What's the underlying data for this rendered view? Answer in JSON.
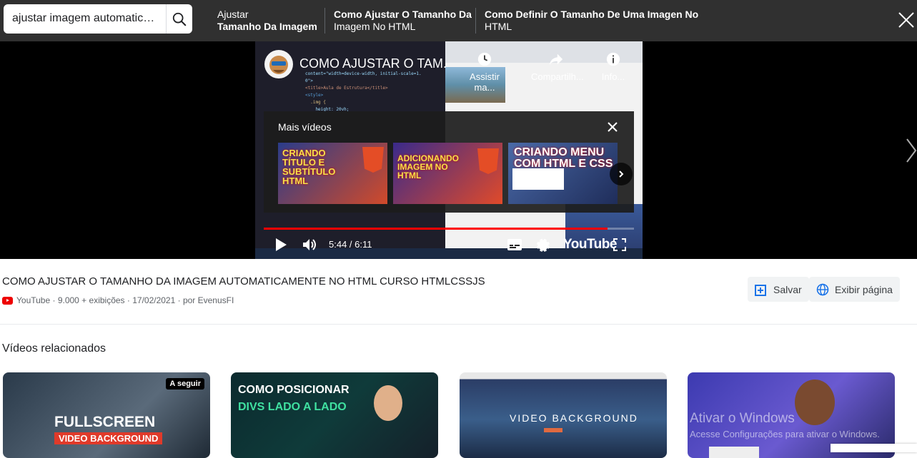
{
  "search": {
    "query": "ajustar imagem automaticamente no html"
  },
  "suggestions": [
    {
      "line1": "Ajustar",
      "line2": "Tamanho Da Imagem"
    },
    {
      "line1": "Como Ajustar O Tamanho Da",
      "line2": "Imagem No HTML"
    },
    {
      "line1": "Como Definir O Tamanho De Uma Imagen No",
      "line2": "HTML"
    }
  ],
  "player": {
    "title": "COMO AJUSTAR O TAM...",
    "watch_later": "Assistir ma...",
    "share": "Compartilh...",
    "info": "Info...",
    "more_videos": "Mais vídeos",
    "time": "5:44 / 6:11",
    "progress": 0.928,
    "brand": "YouTube",
    "more_thumbs": [
      {
        "text": "CRIANDO TÍTULO E SUBTÍTULO HTML",
        "badge": "HTML"
      },
      {
        "text": "ADICIONANDO IMAGEM NO HTML",
        "badge": "HTML"
      },
      {
        "text": "CRIANDO MENU COM HTML E CSS",
        "badge": "HTML"
      }
    ]
  },
  "video": {
    "title": "COMO AJUSTAR O TAMANHO DA IMAGEM AUTOMATICAMENTE NO HTML CURSO HTMLCSSJS",
    "meta": "YouTube · 9.000 + exibições · 17/02/2021 · por EvenusFI",
    "save": "Salvar",
    "open_page": "Exibir página"
  },
  "related": {
    "heading": "Vídeos relacionados",
    "cards": [
      {
        "line1": "FULLSCREEN",
        "line2": "VIDEO BACKGROUND",
        "badge": "A seguir"
      },
      {
        "line1": "COMO POSICIONAR",
        "line2": "DIVS LADO A LADO"
      },
      {
        "line1": "VIDEO BACKGROUND",
        "line2": ""
      },
      {
        "line1": "",
        "line2": ""
      }
    ]
  },
  "windows": {
    "activate": "Ativar o Windows",
    "activate_sub": "Acesse Configurações para ativar o Windows."
  }
}
